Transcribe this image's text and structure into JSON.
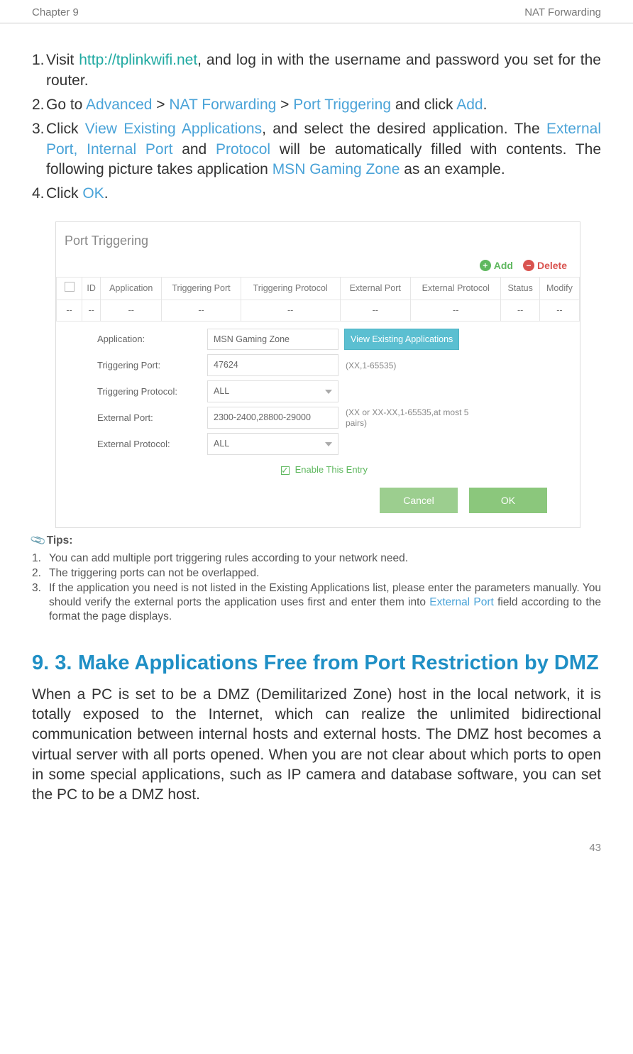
{
  "header": {
    "chapter": "Chapter 9",
    "topic": "NAT Forwarding"
  },
  "steps": {
    "s1a": "Visit ",
    "s1_link": "http://tplinkwifi.net",
    "s1b": ", and log in with the username and password you set for the router.",
    "s2a": "Go to ",
    "s2_adv": "Advanced",
    "s2_gt1": " > ",
    "s2_nat": "NAT Forwarding",
    "s2_gt2": " > ",
    "s2_pt": "Port Triggering",
    "s2b": " and click ",
    "s2_add": "Add",
    "s2_dot": ".",
    "s3a": "Click ",
    "s3_vea": "View Existing Applications",
    "s3b": ", and select the desired application. The ",
    "s3_ep": "External Port, Internal Port",
    "s3c": " and ",
    "s3_proto": "Protocol",
    "s3d": " will be automatically filled with contents. The following picture takes application ",
    "s3_msn": "MSN Gaming Zone",
    "s3e": " as an example.",
    "s4a": "Click ",
    "s4_ok": "OK",
    "s4b": "."
  },
  "screenshot": {
    "title": "Port Triggering",
    "add": "Add",
    "delete": "Delete",
    "th": {
      "id": "ID",
      "app": "Application",
      "tp": "Triggering Port",
      "tproto": "Triggering Protocol",
      "ep": "External Port",
      "eproto": "External Protocol",
      "status": "Status",
      "modify": "Modify"
    },
    "dash": "--",
    "form": {
      "l_app": "Application:",
      "v_app": "MSN Gaming Zone",
      "bt_view": "View Existing Applications",
      "l_tp": "Triggering Port:",
      "v_tp": "47624",
      "h_tp": "(XX,1-65535)",
      "l_tproto": "Triggering Protocol:",
      "v_tproto": "ALL",
      "l_ep": "External Port:",
      "v_ep": "2300-2400,28800-29000",
      "h_ep": "(XX or XX-XX,1-65535,at most 5 pairs)",
      "l_eproto": "External Protocol:",
      "v_eproto": "ALL",
      "enable": "Enable This Entry",
      "cancel": "Cancel",
      "ok": "OK"
    }
  },
  "tips": {
    "label": "Tips:",
    "t1": "You can add multiple port triggering rules according to your network need.",
    "t2": "The triggering ports can not be overlapped.",
    "t3a": "If the application you need is not listed in the Existing Applications list, please enter the parameters manually. You should verify the external ports the application uses first and enter them into ",
    "t3_ep": "External Port",
    "t3b": " field according to the format the page displays."
  },
  "section": {
    "num": "9. 3.",
    "title": "Make Applications Free from Port Restriction by DMZ",
    "body": "When a PC is set to be a DMZ (Demilitarized Zone) host in the local network, it is totally exposed to the Internet, which can realize the unlimited bidirectional communication between internal hosts and external hosts. The DMZ host becomes a virtual server with all ports opened. When you are not clear about which ports to open in some special applications, such as IP camera and database software, you can set the PC to be a DMZ host."
  },
  "footer": {
    "page": "43"
  }
}
